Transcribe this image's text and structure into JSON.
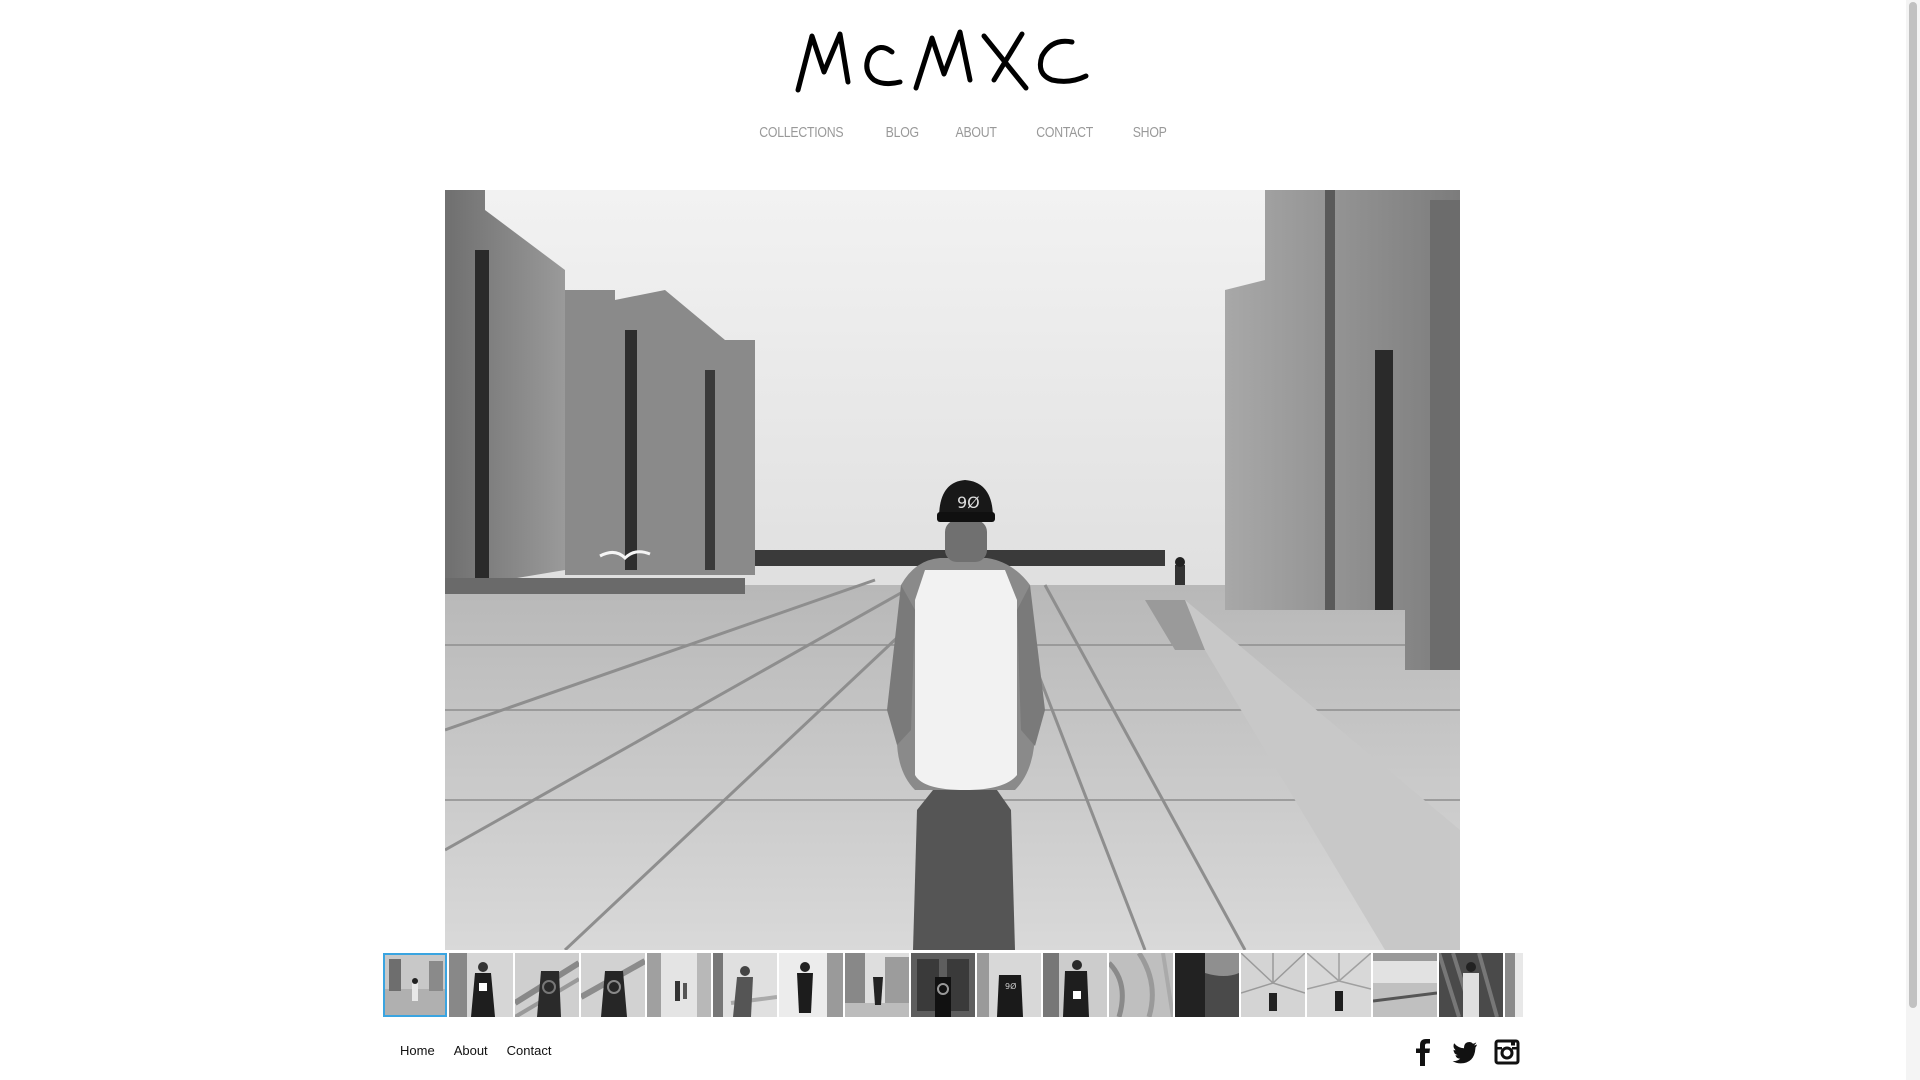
{
  "site": {
    "logo_text": "MCMXC"
  },
  "nav": {
    "items": [
      {
        "label": "COLLECTIONS"
      },
      {
        "label": "BLOG"
      },
      {
        "label": "ABOUT"
      },
      {
        "label": "CONTACT"
      },
      {
        "label": "SHOP"
      }
    ]
  },
  "gallery": {
    "thumbnail_count": 18,
    "active_index": 0,
    "active_color": "#3aa4e0"
  },
  "footer": {
    "links": [
      {
        "label": "Home"
      },
      {
        "label": "About"
      },
      {
        "label": "Contact"
      }
    ],
    "social": [
      "facebook-icon",
      "twitter-icon",
      "instagram-icon"
    ]
  }
}
